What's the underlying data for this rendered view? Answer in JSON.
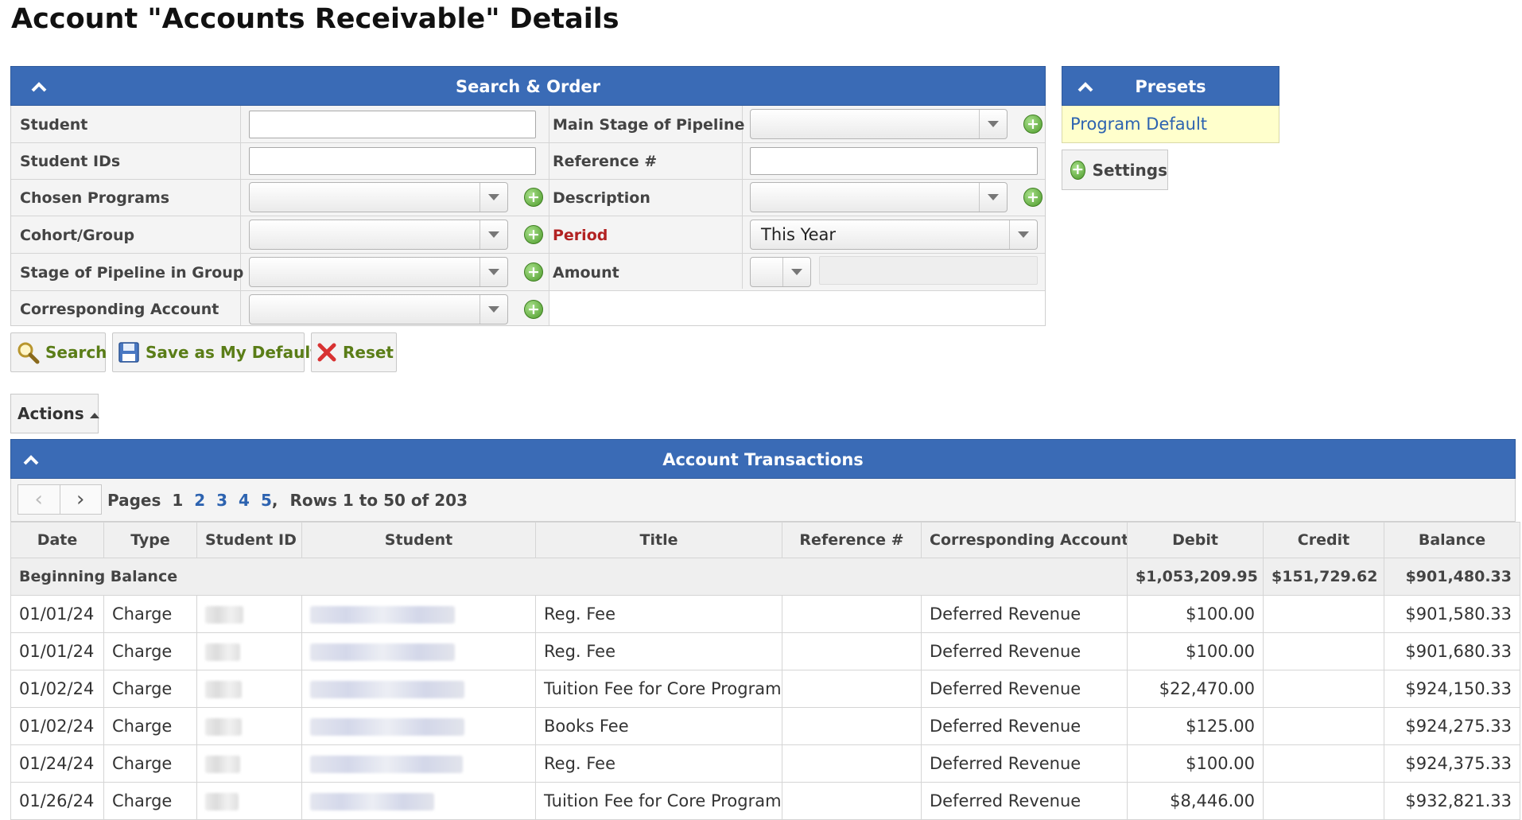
{
  "page": {
    "title": "Account \"Accounts Receivable\" Details"
  },
  "search_panel": {
    "title": "Search & Order",
    "fields": {
      "student": "Student",
      "student_ids": "Student IDs",
      "chosen_programs": "Chosen Programs",
      "cohort_group": "Cohort/Group",
      "stage_in_group": "Stage of Pipeline in Group",
      "corresponding_account": "Corresponding Account",
      "main_stage": "Main Stage of Pipeline",
      "reference": "Reference #",
      "description": "Description",
      "period": "Period",
      "amount": "Amount"
    },
    "period_value": "This Year"
  },
  "buttons": {
    "search": "Search",
    "save_default": "Save as My Default",
    "reset": "Reset",
    "settings": "Settings",
    "actions": "Actions"
  },
  "presets": {
    "title": "Presets",
    "items": [
      "Program Default"
    ]
  },
  "transactions": {
    "title": "Account Transactions",
    "pager": {
      "label": "Pages",
      "pages": [
        "1",
        "2",
        "3",
        "4",
        "5"
      ],
      "rows_info": "Rows 1 to 50 of 203"
    },
    "columns": [
      "Date",
      "Type",
      "Student ID",
      "Student",
      "Title",
      "Reference #",
      "Corresponding Account",
      "Debit",
      "Credit",
      "Balance"
    ],
    "beginning": {
      "label": "Beginning Balance",
      "debit": "$1,053,209.95",
      "credit": "$151,729.62",
      "balance": "$901,480.33"
    },
    "rows": [
      {
        "date": "01/01/24",
        "type": "Charge",
        "title": "Reg. Fee",
        "account": "Deferred Revenue",
        "debit": "$100.00",
        "credit": "",
        "balance": "$901,580.33"
      },
      {
        "date": "01/01/24",
        "type": "Charge",
        "title": "Reg. Fee",
        "account": "Deferred Revenue",
        "debit": "$100.00",
        "credit": "",
        "balance": "$901,680.33"
      },
      {
        "date": "01/02/24",
        "type": "Charge",
        "title": "Tuition Fee for Core Program",
        "account": "Deferred Revenue",
        "debit": "$22,470.00",
        "credit": "",
        "balance": "$924,150.33"
      },
      {
        "date": "01/02/24",
        "type": "Charge",
        "title": "Books Fee",
        "account": "Deferred Revenue",
        "debit": "$125.00",
        "credit": "",
        "balance": "$924,275.33"
      },
      {
        "date": "01/24/24",
        "type": "Charge",
        "title": "Reg. Fee",
        "account": "Deferred Revenue",
        "debit": "$100.00",
        "credit": "",
        "balance": "$924,375.33"
      },
      {
        "date": "01/26/24",
        "type": "Charge",
        "title": "Tuition Fee for Core Program",
        "account": "Deferred Revenue",
        "debit": "$8,446.00",
        "credit": "",
        "balance": "$932,821.33"
      }
    ]
  }
}
